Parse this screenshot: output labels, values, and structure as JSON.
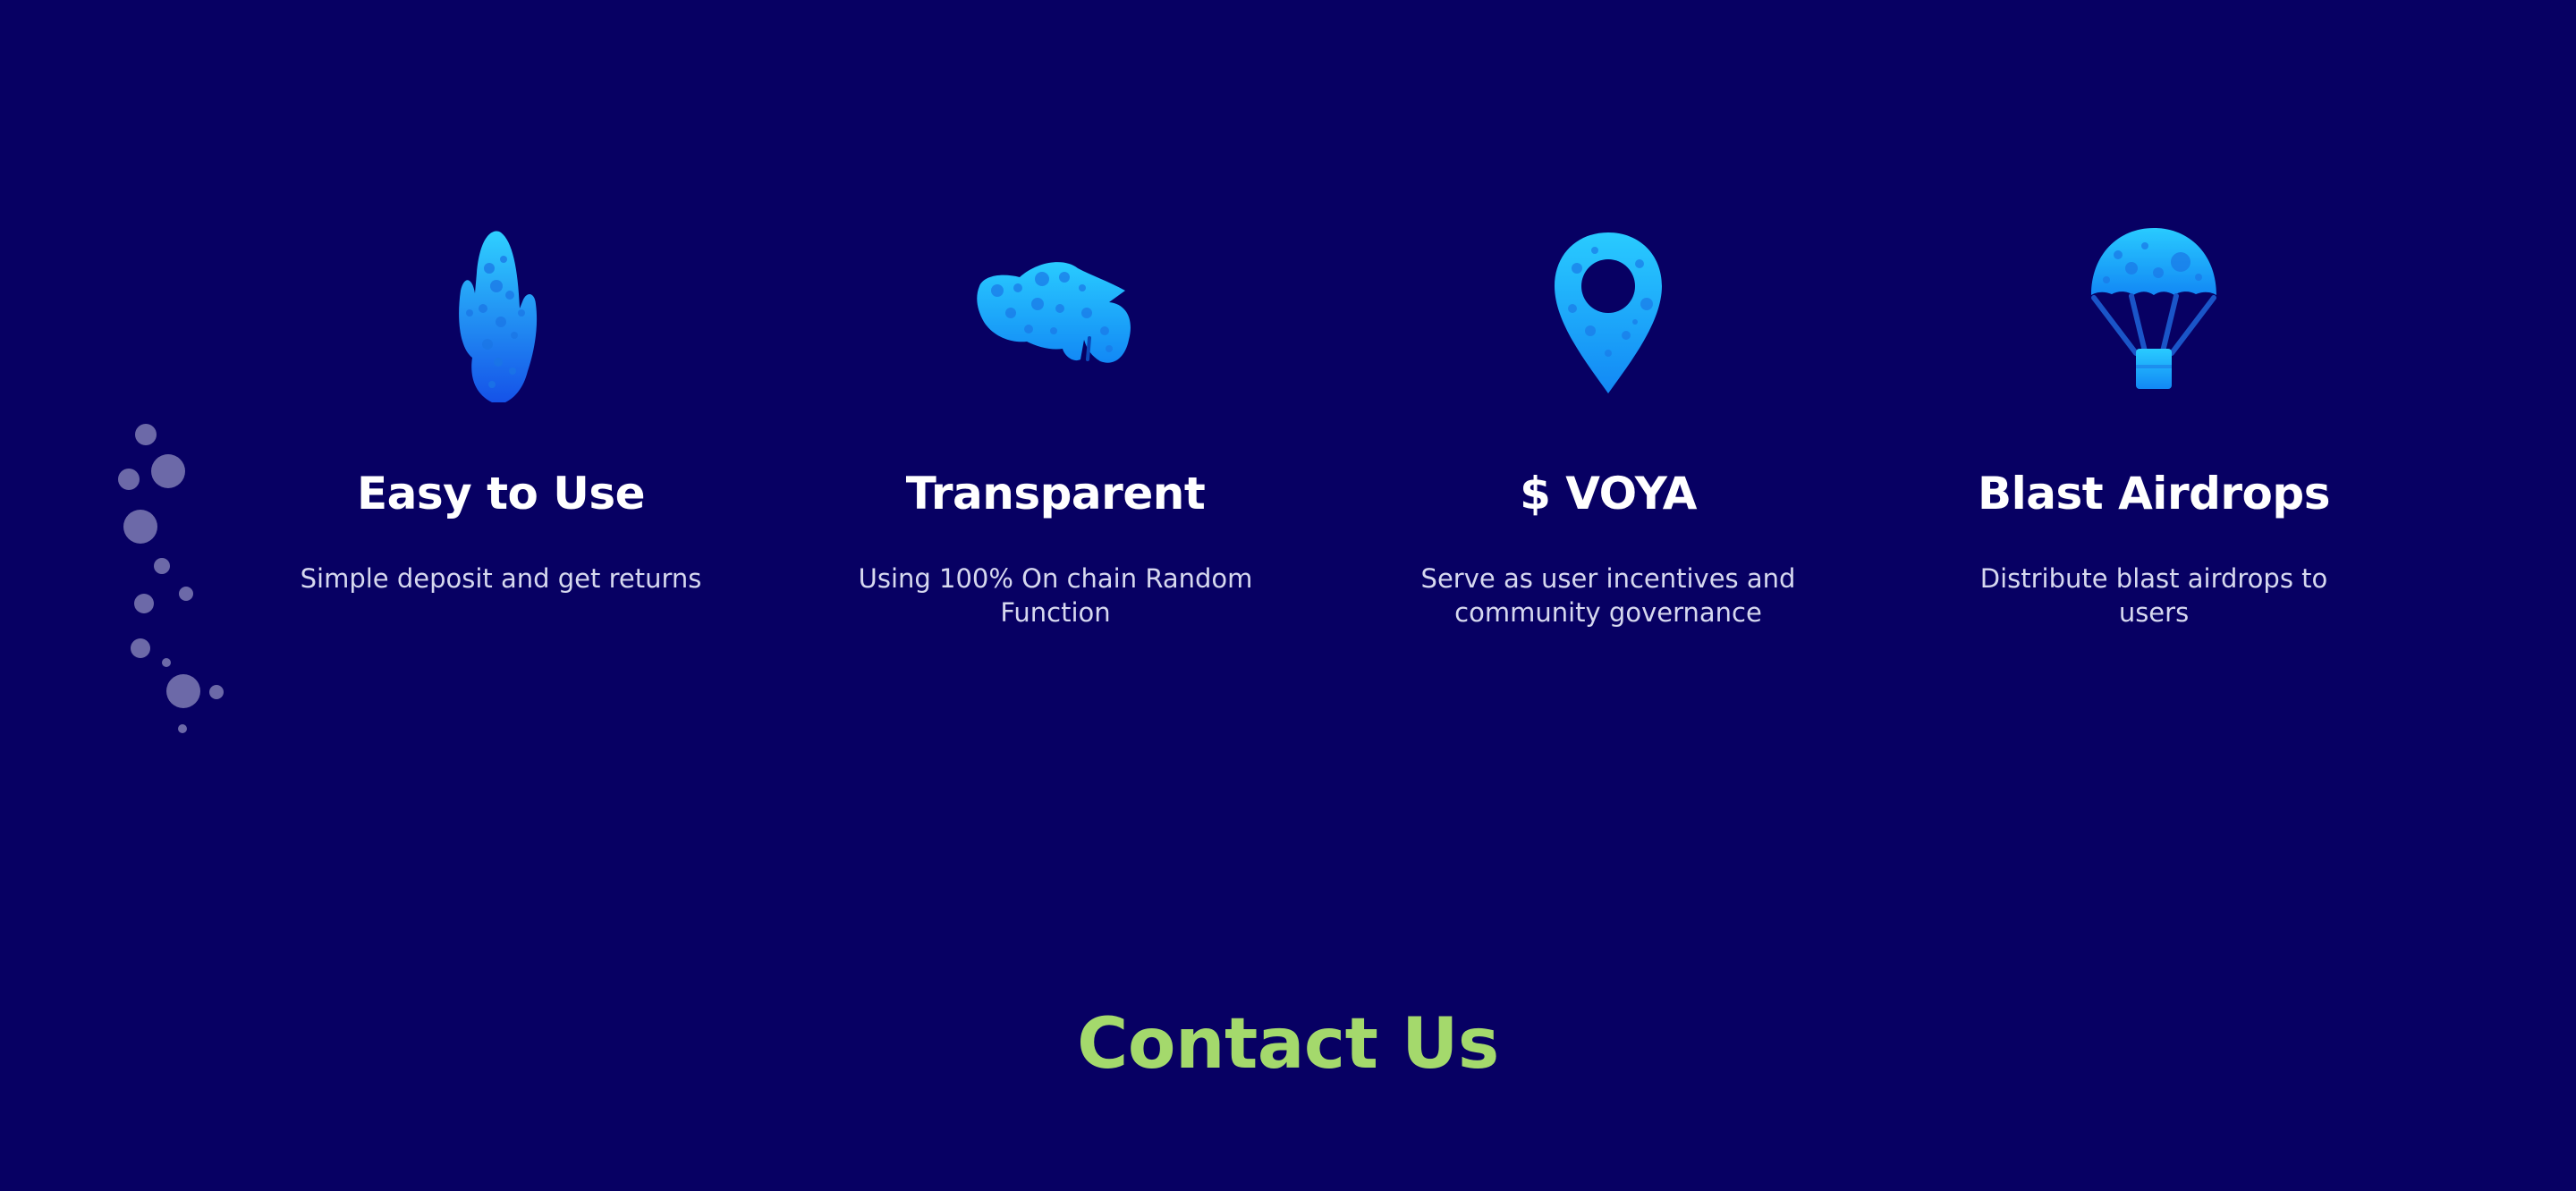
{
  "colors": {
    "background": "#070063",
    "title": "#ffffff",
    "description": "#d6d8ef",
    "accent_green": "#a4d96c",
    "icon_light": "#22c6ff",
    "icon_dark": "#0a6cf0",
    "bubble": "#7e7bb4"
  },
  "features": [
    {
      "icon": "coral-icon",
      "title": "Easy to Use",
      "description_lines": [
        "Simple deposit and get returns"
      ]
    },
    {
      "icon": "fish-icon",
      "title": "Transparent",
      "description_lines": [
        "Using 100% On chain Random",
        "Function"
      ]
    },
    {
      "icon": "location-pin-icon",
      "title": "$ VOYA",
      "description_lines": [
        "Serve as user incentives and",
        "community governance"
      ]
    },
    {
      "icon": "parachute-icon",
      "title": "Blast Airdrops",
      "description_lines": [
        "Distribute blast airdrops to",
        "users"
      ]
    }
  ],
  "contact": {
    "title": "Contact Us"
  }
}
